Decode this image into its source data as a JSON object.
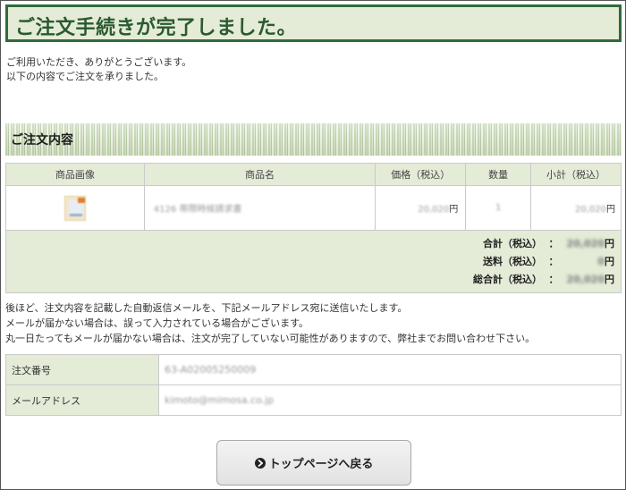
{
  "page": {
    "title": "ご注文手続きが完了しました。",
    "intro_line1": "ご利用いただき、ありがとうございます。",
    "intro_line2": "以下の内容でご注文を承りました。"
  },
  "order_section": {
    "heading": "ご注文内容",
    "columns": [
      "商品画像",
      "商品名",
      "価格（税込）",
      "数量",
      "小計（税込）"
    ],
    "items": [
      {
        "image_icon": "product-thumbnail",
        "name": "4126 帯際時候請求書",
        "price": "20,020",
        "price_unit": "円",
        "quantity": "1",
        "subtotal": "20,020",
        "subtotal_unit": "円"
      }
    ],
    "totals": [
      {
        "label": "合計（税込）",
        "colon": "：",
        "value": "20,020",
        "unit": "円"
      },
      {
        "label": "送料（税込）",
        "colon": "：",
        "value": "0",
        "unit": "円"
      },
      {
        "label": "総合計（税込）",
        "colon": "：",
        "value": "20,020",
        "unit": "円"
      }
    ]
  },
  "notice": {
    "line1": "後ほど、注文内容を記載した自動返信メールを、下記メールアドレス宛に送信いたします。",
    "line2": "メールが届かない場合は、誤って入力されている場合がございます。",
    "line3": "丸一日たってもメールが届かない場合は、注文が完了していない可能性がありますので、弊社までお問い合わせ下さい。"
  },
  "info": [
    {
      "key": "注文番号",
      "value": "63-A02005250009"
    },
    {
      "key": "メールアドレス",
      "value": "kimoto@mimosa.co.jp"
    }
  ],
  "button": {
    "icon": "circle-chevron-right-icon",
    "label": "トップページへ戻る"
  },
  "colors": {
    "accent_green": "#2f6b3a",
    "light_green": "#e4ebd7"
  }
}
